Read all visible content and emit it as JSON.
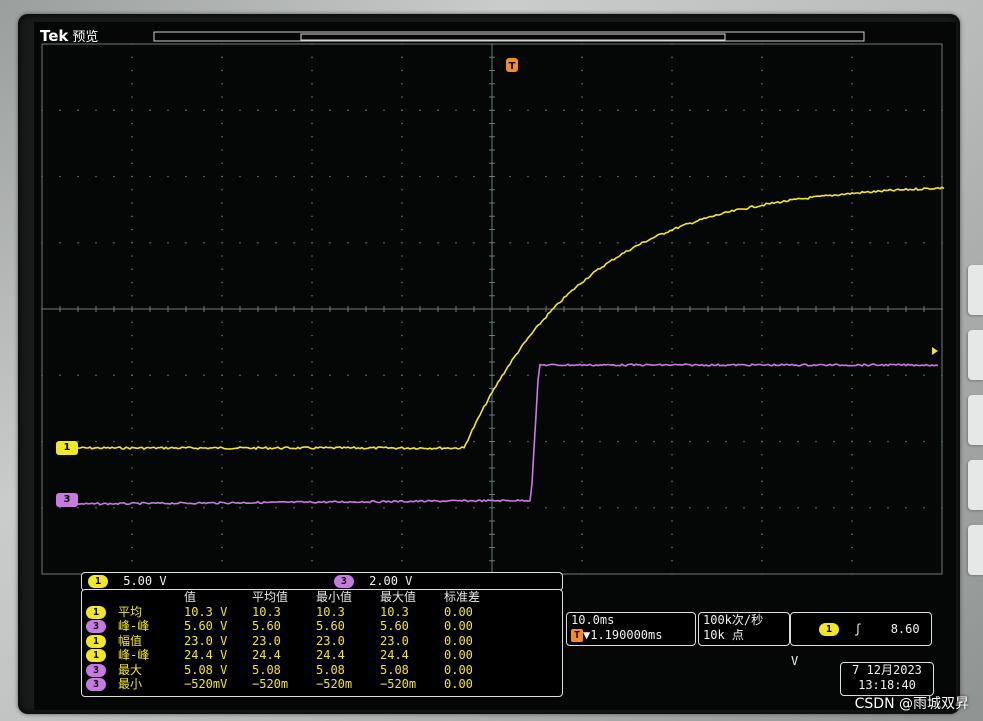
{
  "brand": {
    "logo": "Tek",
    "mode": "预览"
  },
  "colors": {
    "ch1": "#f2e62a",
    "ch3": "#c77be0",
    "grid": "#6a7a7a"
  },
  "markers": {
    "trigger": "T",
    "ch1": "1",
    "ch3": "3"
  },
  "vscale": {
    "ch1_badge": "1",
    "ch1_scale": "5.00 V",
    "ch3_badge": "3",
    "ch3_scale": "2.00 V"
  },
  "measurements": {
    "headers": [
      "值",
      "平均值",
      "最小值",
      "最大值",
      "标准差"
    ],
    "rows": [
      {
        "ch": "1",
        "name": "平均",
        "values": [
          "10.3 V",
          "10.3",
          "10.3",
          "10.3",
          "0.00"
        ]
      },
      {
        "ch": "3",
        "name": "峰-峰",
        "values": [
          "5.60 V",
          "5.60",
          "5.60",
          "5.60",
          "0.00"
        ]
      },
      {
        "ch": "1",
        "name": "幅值",
        "values": [
          "23.0 V",
          "23.0",
          "23.0",
          "23.0",
          "0.00"
        ]
      },
      {
        "ch": "1",
        "name": "峰-峰",
        "values": [
          "24.4 V",
          "24.4",
          "24.4",
          "24.4",
          "0.00"
        ]
      },
      {
        "ch": "3",
        "name": "最大",
        "values": [
          "5.08 V",
          "5.08",
          "5.08",
          "5.08",
          "0.00"
        ]
      },
      {
        "ch": "3",
        "name": "最小",
        "values": [
          "−520mV",
          "−520m",
          "−520m",
          "−520m",
          "0.00"
        ]
      }
    ]
  },
  "timebase": {
    "scale": "10.0ms",
    "trigger_pos": "▼1.190000ms",
    "trig_icon": "T"
  },
  "acquisition": {
    "rate": "100k次/秒",
    "points": "10k 点"
  },
  "trigger": {
    "ch": "1",
    "slope": "ʃ",
    "level": "8.60 V"
  },
  "datetime": {
    "date": "7 12月2023",
    "time": "13:18:40"
  },
  "watermark": "CSDN @雨城双昇"
}
